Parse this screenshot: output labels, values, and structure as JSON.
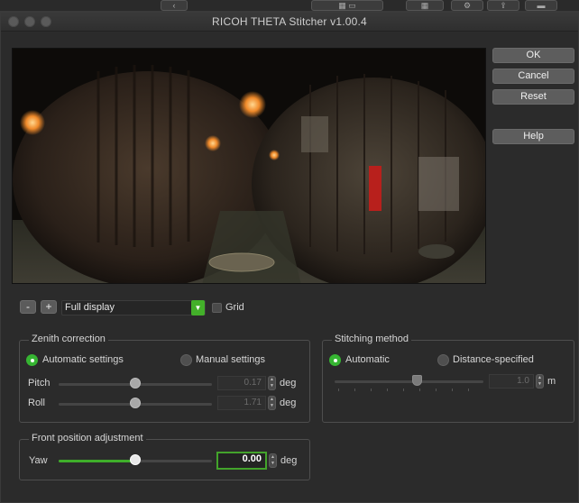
{
  "window": {
    "title": "RICOH THETA Stitcher v1.00.4"
  },
  "buttons": {
    "ok": "OK",
    "cancel": "Cancel",
    "reset": "Reset",
    "help": "Help"
  },
  "display": {
    "minus_label": "-",
    "plus_label": "+",
    "mode_value": "Full display",
    "grid_label": "Grid",
    "grid_checked": false
  },
  "zenith": {
    "title": "Zenith correction",
    "automatic_label": "Automatic settings",
    "manual_label": "Manual settings",
    "selected": "Automatic settings",
    "pitch": {
      "label": "Pitch",
      "value": "0.17",
      "unit": "deg",
      "level": 0.5
    },
    "roll": {
      "label": "Roll",
      "value": "1.71",
      "unit": "deg",
      "level": 0.5
    }
  },
  "stitching": {
    "title": "Stitching method",
    "automatic_label": "Automatic",
    "distance_label": "Distance-specified",
    "selected": "Automatic",
    "distance": {
      "value": "1.0",
      "unit": "m",
      "level": 0.55
    }
  },
  "front": {
    "title": "Front position adjustment",
    "yaw": {
      "label": "Yaw",
      "value": "0.00",
      "unit": "deg",
      "level": 0.5
    }
  },
  "colors": {
    "accent_green": "#3fae2a",
    "button_gray": "#5d5d5d",
    "background": "#2b2b2b"
  },
  "icons": {
    "window_controls": [
      "close-icon",
      "minimize-icon",
      "zoom-icon"
    ],
    "select_arrow": "chevron-down-icon",
    "stepper": "up-down-arrows-icon"
  }
}
